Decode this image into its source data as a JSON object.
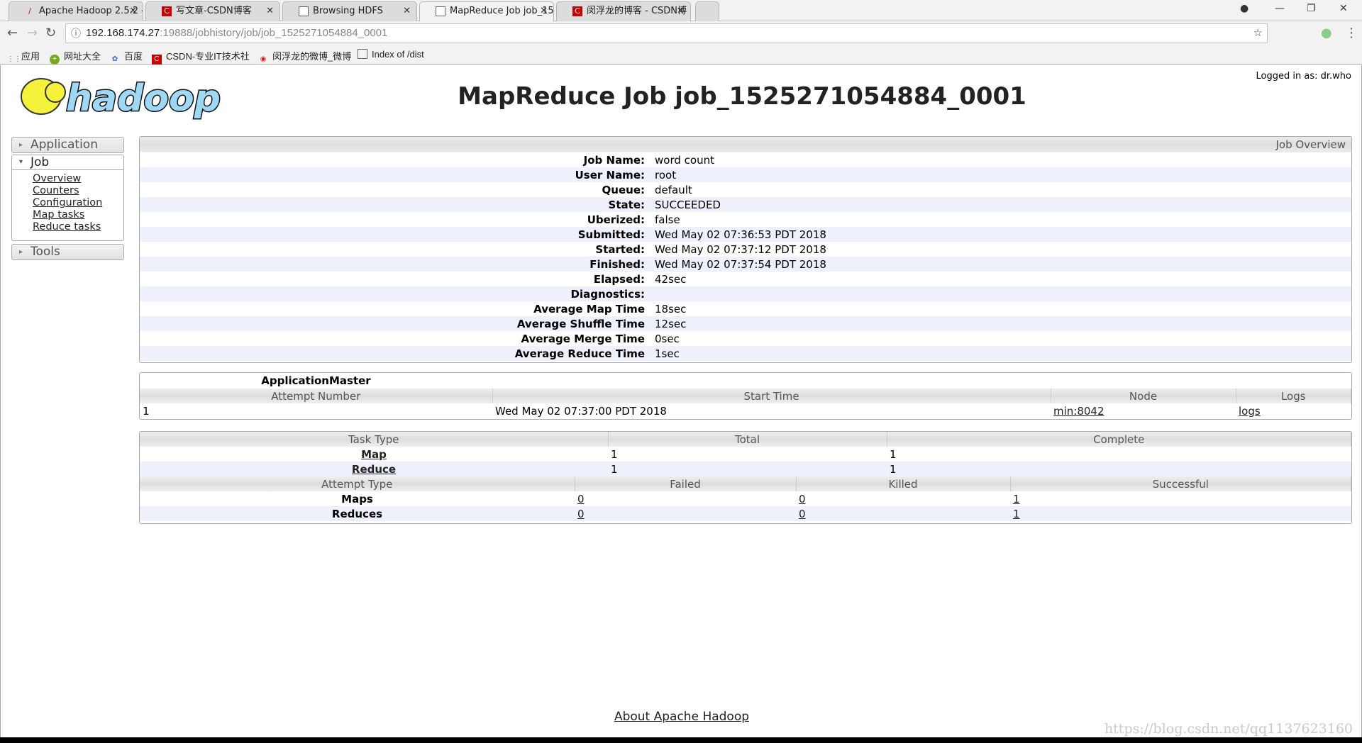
{
  "browser": {
    "tabs": [
      {
        "title": "Apache Hadoop 2.5.2 -",
        "icon": "hadoop-icon"
      },
      {
        "title": "写文章-CSDN博客",
        "icon": "csdn-icon"
      },
      {
        "title": "Browsing HDFS",
        "icon": "page-icon"
      },
      {
        "title": "MapReduce Job job_15",
        "icon": "page-icon",
        "active": true
      },
      {
        "title": "闵浮龙的博客 - CSDN博",
        "icon": "csdn-icon"
      }
    ],
    "url_host": "192.168.174.27",
    "url_path": ":19888/jobhistory/job/job_1525271054884_0001",
    "bookmarks": [
      "应用",
      "网址大全",
      "百度",
      "CSDN-专业IT技术社",
      "闵浮龙的微博_微博",
      "Index of /dist"
    ]
  },
  "header": {
    "logo_text": "hadoop",
    "title": "MapReduce Job job_1525271054884_0001",
    "logged_in": "Logged in as: dr.who"
  },
  "sidebar": {
    "application": "Application",
    "job": "Job",
    "job_links": [
      "Overview",
      "Counters",
      "Configuration",
      "Map tasks",
      "Reduce tasks"
    ],
    "tools": "Tools"
  },
  "overview": {
    "heading": "Job Overview",
    "rows": [
      {
        "label": "Job Name:",
        "value": "word count"
      },
      {
        "label": "User Name:",
        "value": "root"
      },
      {
        "label": "Queue:",
        "value": "default"
      },
      {
        "label": "State:",
        "value": "SUCCEEDED"
      },
      {
        "label": "Uberized:",
        "value": "false"
      },
      {
        "label": "Submitted:",
        "value": "Wed May 02 07:36:53 PDT 2018"
      },
      {
        "label": "Started:",
        "value": "Wed May 02 07:37:12 PDT 2018"
      },
      {
        "label": "Finished:",
        "value": "Wed May 02 07:37:54 PDT 2018"
      },
      {
        "label": "Elapsed:",
        "value": "42sec"
      },
      {
        "label": "Diagnostics:",
        "value": ""
      },
      {
        "label": "Average Map Time",
        "value": "18sec"
      },
      {
        "label": "Average Shuffle Time",
        "value": "12sec"
      },
      {
        "label": "Average Merge Time",
        "value": "0sec"
      },
      {
        "label": "Average Reduce Time",
        "value": "1sec"
      }
    ]
  },
  "am": {
    "title": "ApplicationMaster",
    "headers": [
      "Attempt Number",
      "Start Time",
      "Node",
      "Logs"
    ],
    "row": {
      "attempt": "1",
      "start": "Wed May 02 07:37:00 PDT 2018",
      "node": "min:8042",
      "logs": "logs"
    }
  },
  "tasks": {
    "headers": [
      "Task Type",
      "Total",
      "Complete"
    ],
    "rows": [
      {
        "type": "Map",
        "total": "1",
        "complete": "1"
      },
      {
        "type": "Reduce",
        "total": "1",
        "complete": "1"
      }
    ],
    "attempt_headers": [
      "Attempt Type",
      "Failed",
      "Killed",
      "Successful"
    ],
    "attempt_rows": [
      {
        "type": "Maps",
        "failed": "0",
        "killed": "0",
        "successful": "1"
      },
      {
        "type": "Reduces",
        "failed": "0",
        "killed": "0",
        "successful": "1"
      }
    ]
  },
  "footer": {
    "about": "About Apache Hadoop",
    "watermark": "https://blog.csdn.net/qq1137623160"
  }
}
